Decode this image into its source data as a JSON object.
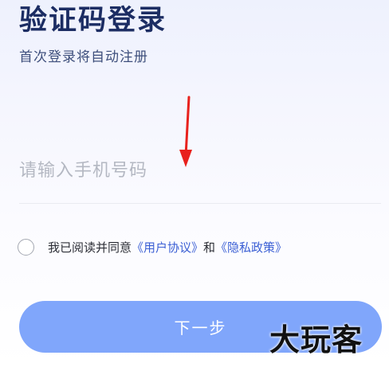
{
  "login": {
    "title": "验证码登录",
    "subtitle": "首次登录将自动注册"
  },
  "phone": {
    "placeholder": "请输入手机号码",
    "value": ""
  },
  "agreement": {
    "checked": false,
    "prefix": "我已阅读并同意",
    "user_agreement_link": "《用户协议》",
    "conjunction": "和",
    "privacy_policy_link": "《隐私政策》"
  },
  "next_button": {
    "label": "下一步",
    "color": "#80a6fb"
  },
  "annotation": {
    "arrow_color": "#e8211d"
  },
  "watermark": {
    "text": "大玩客"
  },
  "colors": {
    "title": "#1c2d63",
    "link": "#3b5fd4",
    "placeholder": "#b4b8c2"
  }
}
